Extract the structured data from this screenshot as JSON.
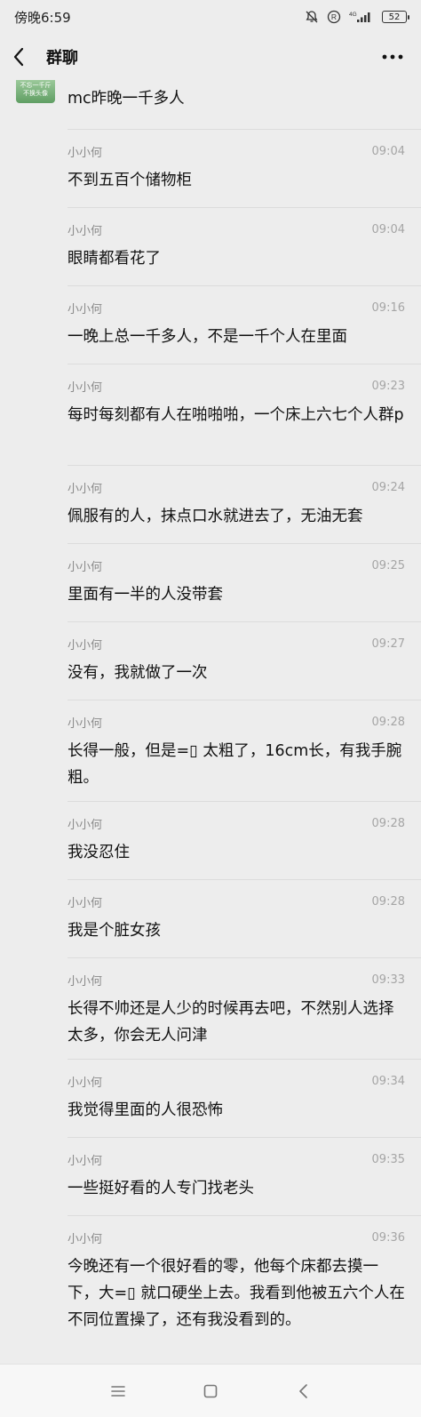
{
  "status_bar": {
    "time": "傍晚6:59",
    "battery": "52",
    "network": "4G"
  },
  "header": {
    "title": "群聊"
  },
  "avatar": {
    "line1": "不忘一千斤",
    "line2": "不换头像"
  },
  "messages": [
    {
      "sender": "",
      "time": "",
      "text": "mc昨晚一千多人"
    },
    {
      "sender": "小小何",
      "time": "09:04",
      "text": "不到五百个储物柜"
    },
    {
      "sender": "小小何",
      "time": "09:04",
      "text": "眼睛都看花了"
    },
    {
      "sender": "小小何",
      "time": "09:16",
      "text": "一晚上总一千多人，不是一千个人在里面"
    },
    {
      "sender": "小小何",
      "time": "09:23",
      "text": "每时每刻都有人在啪啪啪，一个床上六七个人群p"
    },
    {
      "sender": "小小何",
      "time": "09:24",
      "text": "佩服有的人，抹点口水就进去了，无油无套"
    },
    {
      "sender": "小小何",
      "time": "09:25",
      "text": "里面有一半的人没带套"
    },
    {
      "sender": "小小何",
      "time": "09:27",
      "text": "没有，我就做了一次"
    },
    {
      "sender": "小小何",
      "time": "09:28",
      "text": "长得一般，但是=▯ 太粗了，16cm长，有我手腕粗。"
    },
    {
      "sender": "小小何",
      "time": "09:28",
      "text": "我没忍住"
    },
    {
      "sender": "小小何",
      "time": "09:28",
      "text": "我是个脏女孩"
    },
    {
      "sender": "小小何",
      "time": "09:33",
      "text": "长得不帅还是人少的时候再去吧，不然别人选择太多，你会无人问津"
    },
    {
      "sender": "小小何",
      "time": "09:34",
      "text": "我觉得里面的人很恐怖"
    },
    {
      "sender": "小小何",
      "time": "09:35",
      "text": "一些挺好看的人专门找老头"
    },
    {
      "sender": "小小何",
      "time": "09:36",
      "text": "今晚还有一个很好看的零，他每个床都去摸一下，大=▯ 就口硬坐上去。我看到他被五六个人在不同位置操了，还有我没看到的。"
    }
  ],
  "icons": {
    "back": "chevron-left-icon",
    "more": "more-dots-icon",
    "menu": "hamburger-icon",
    "home": "square-icon",
    "sys_back": "triangle-back-icon",
    "mute": "bell-off-icon",
    "nfc": "registered-icon",
    "signal": "signal-icon"
  }
}
